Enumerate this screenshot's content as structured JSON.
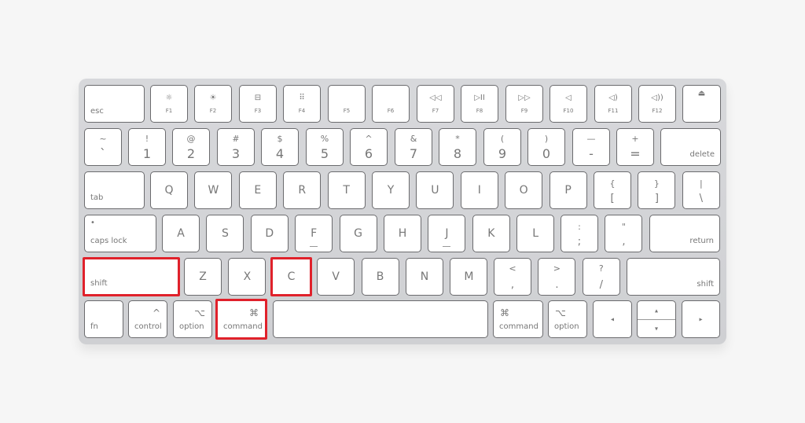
{
  "keyboard": {
    "highlight_color": "#e0212b",
    "highlighted_keys": [
      "shift",
      "C",
      "command"
    ],
    "function_row": [
      {
        "name": "esc",
        "label": "esc"
      },
      {
        "name": "f1",
        "icon": "☼",
        "label": "F1"
      },
      {
        "name": "f2",
        "icon": "☀",
        "label": "F2"
      },
      {
        "name": "f3",
        "icon": "⊟",
        "label": "F3"
      },
      {
        "name": "f4",
        "icon": "⠿",
        "label": "F4"
      },
      {
        "name": "f5",
        "icon": "",
        "label": "F5"
      },
      {
        "name": "f6",
        "icon": "",
        "label": "F6"
      },
      {
        "name": "f7",
        "icon": "◁◁",
        "label": "F7"
      },
      {
        "name": "f8",
        "icon": "▷II",
        "label": "F8"
      },
      {
        "name": "f9",
        "icon": "▷▷",
        "label": "F9"
      },
      {
        "name": "f10",
        "icon": "◁",
        "label": "F10"
      },
      {
        "name": "f11",
        "icon": "◁)",
        "label": "F11"
      },
      {
        "name": "f12",
        "icon": "◁))",
        "label": "F12"
      },
      {
        "name": "eject",
        "icon": "⏏",
        "label": ""
      }
    ],
    "number_row": [
      {
        "top": "~",
        "bottom": "`"
      },
      {
        "top": "!",
        "bottom": "1"
      },
      {
        "top": "@",
        "bottom": "2"
      },
      {
        "top": "#",
        "bottom": "3"
      },
      {
        "top": "$",
        "bottom": "4"
      },
      {
        "top": "%",
        "bottom": "5"
      },
      {
        "top": "^",
        "bottom": "6"
      },
      {
        "top": "&",
        "bottom": "7"
      },
      {
        "top": "*",
        "bottom": "8"
      },
      {
        "top": "(",
        "bottom": "9"
      },
      {
        "top": ")",
        "bottom": "0"
      },
      {
        "top": "—",
        "bottom": "-"
      },
      {
        "top": "+",
        "bottom": "="
      },
      {
        "label": "delete"
      }
    ],
    "qwerty_row": {
      "tab": "tab",
      "letters": [
        "Q",
        "W",
        "E",
        "R",
        "T",
        "Y",
        "U",
        "I",
        "O",
        "P"
      ],
      "brackets": [
        {
          "top": "{",
          "bottom": "["
        },
        {
          "top": "}",
          "bottom": "]"
        },
        {
          "top": "|",
          "bottom": "\\"
        }
      ]
    },
    "home_row": {
      "caps": "caps lock",
      "caps_dot": "•",
      "letters": [
        "A",
        "S",
        "D",
        "F",
        "G",
        "H",
        "J",
        "K",
        "L"
      ],
      "punct": [
        {
          "top": ":",
          "bottom": ";"
        },
        {
          "top": "\"",
          "bottom": ","
        }
      ],
      "return": "return"
    },
    "shift_row": {
      "left_shift": "shift",
      "letters": [
        "Z",
        "X",
        "C",
        "V",
        "B",
        "N",
        "M"
      ],
      "punct": [
        {
          "top": "<",
          "bottom": ","
        },
        {
          "top": ">",
          "bottom": "."
        },
        {
          "top": "?",
          "bottom": "/"
        }
      ],
      "right_shift": "shift"
    },
    "bottom_row": {
      "fn": "fn",
      "control": "control",
      "control_sym": "^",
      "option": "option",
      "option_sym": "⌥",
      "command": "command",
      "command_sym": "⌘",
      "r_command": "command",
      "r_command_sym": "⌘",
      "r_option": "option",
      "r_option_sym": "⌥",
      "left": "◂",
      "up": "▴",
      "down": "▾",
      "right": "▸"
    }
  }
}
